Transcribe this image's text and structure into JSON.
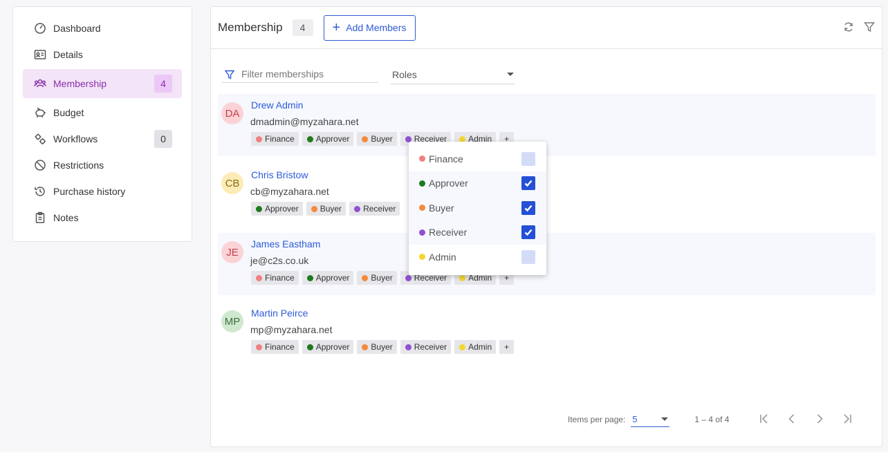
{
  "sidebar": {
    "items": [
      {
        "label": "Dashboard",
        "icon": "dashboard-icon"
      },
      {
        "label": "Details",
        "icon": "id-card-icon"
      },
      {
        "label": "Membership",
        "icon": "users-icon",
        "count": "4",
        "active": true
      },
      {
        "label": "Budget",
        "icon": "piggy-bank-icon"
      },
      {
        "label": "Workflows",
        "icon": "gears-icon",
        "count": "0"
      },
      {
        "label": "Restrictions",
        "icon": "prohibited-icon"
      },
      {
        "label": "Purchase history",
        "icon": "history-icon"
      },
      {
        "label": "Notes",
        "icon": "clipboard-icon"
      }
    ]
  },
  "header": {
    "title": "Membership",
    "count": "4",
    "add_label": "Add Members"
  },
  "filters": {
    "placeholder": "Filter memberships",
    "roles_label": "Roles"
  },
  "roles": {
    "Finance": "#f08080",
    "Approver": "#1e7a1e",
    "Buyer": "#f58a3c",
    "Receiver": "#9150d0",
    "Admin": "#f5d631"
  },
  "members": [
    {
      "initials": "DA",
      "name": "Drew Admin",
      "email": "dmadmin@myzahara.net",
      "avatar_bg": "#fbd3d6",
      "avatar_fg": "#c54050",
      "tags": [
        "Finance",
        "Approver",
        "Buyer",
        "Receiver",
        "Admin"
      ],
      "more": "+"
    },
    {
      "initials": "CB",
      "name": "Chris Bristow",
      "email": "cb@myzahara.net",
      "avatar_bg": "#fdecb8",
      "avatar_fg": "#8a6a14",
      "tags": [
        "Approver",
        "Buyer",
        "Receiver"
      ],
      "more": ""
    },
    {
      "initials": "JE",
      "name": "James Eastham",
      "email": "je@c2s.co.uk",
      "avatar_bg": "#fbd3d6",
      "avatar_fg": "#c54050",
      "tags": [
        "Finance",
        "Approver",
        "Buyer",
        "Receiver",
        "Admin"
      ],
      "more": "+"
    },
    {
      "initials": "MP",
      "name": "Martin Peirce",
      "email": "mp@myzahara.net",
      "avatar_bg": "#cfe8cf",
      "avatar_fg": "#3f6e3f",
      "tags": [
        "Finance",
        "Approver",
        "Buyer",
        "Receiver",
        "Admin"
      ],
      "more": "+"
    }
  ],
  "role_dropdown": {
    "options": [
      {
        "label": "Finance",
        "checked": false
      },
      {
        "label": "Approver",
        "checked": true
      },
      {
        "label": "Buyer",
        "checked": true
      },
      {
        "label": "Receiver",
        "checked": true
      },
      {
        "label": "Admin",
        "checked": false
      }
    ]
  },
  "pagination": {
    "items_per_page_label": "Items per page:",
    "items_per_page": "5",
    "range": "1 – 4 of 4"
  },
  "colors": {
    "accent": "#2d5bd8",
    "active_nav": "#8a2fa8",
    "active_nav_bg": "#f3e4f8"
  }
}
